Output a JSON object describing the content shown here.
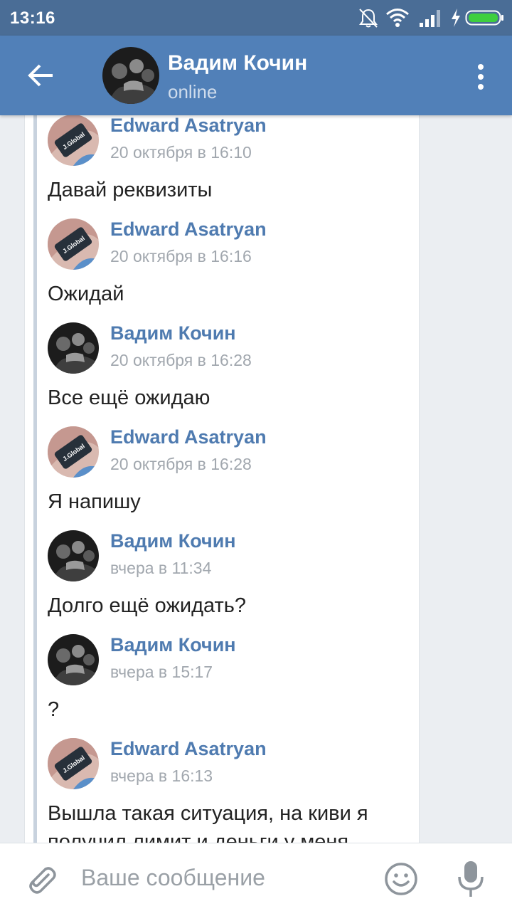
{
  "status_bar": {
    "time": "13:16",
    "icons": [
      "bell-off-icon",
      "wifi-icon",
      "signal-icon",
      "charging-bolt-icon",
      "battery-icon"
    ]
  },
  "header": {
    "name": "Вадим Кочин",
    "status": "online",
    "back_icon": "arrow-left-icon",
    "menu_icon": "more-vertical-icon"
  },
  "messages": [
    {
      "author": "Edward Asatryan",
      "date": "20 октября в 16:10",
      "text": "Давай реквизиты",
      "avatar": "edward"
    },
    {
      "author": "Edward Asatryan",
      "date": "20 октября в 16:16",
      "text": "Ожидай",
      "avatar": "edward"
    },
    {
      "author": "Вадим Кочин",
      "date": "20 октября в 16:28",
      "text": "Все ещё ожидаю",
      "avatar": "vadim"
    },
    {
      "author": "Edward Asatryan",
      "date": "20 октября в 16:28",
      "text": "Я напишу",
      "avatar": "edward"
    },
    {
      "author": "Вадим Кочин",
      "date": "вчера в 11:34",
      "text": "Долго ещё ожидать?",
      "avatar": "vadim"
    },
    {
      "author": "Вадим Кочин",
      "date": "вчера в 15:17",
      "text": "?",
      "avatar": "vadim"
    },
    {
      "author": "Edward Asatryan",
      "date": "вчера в 16:13",
      "text": "Вышла такая ситуация, на киви я получил лимит и деньги у меня",
      "avatar": "edward"
    }
  ],
  "avatar_caption": "J.Global",
  "input_bar": {
    "placeholder": "Ваше сообщение",
    "icons": [
      "paperclip-icon",
      "smile-icon",
      "microphone-icon"
    ]
  },
  "colors": {
    "status_bar": "#4a6d96",
    "toolbar": "#5180b8",
    "author_name": "#4f7bb0",
    "date": "#a1a7ae",
    "background": "#ebeef2"
  }
}
